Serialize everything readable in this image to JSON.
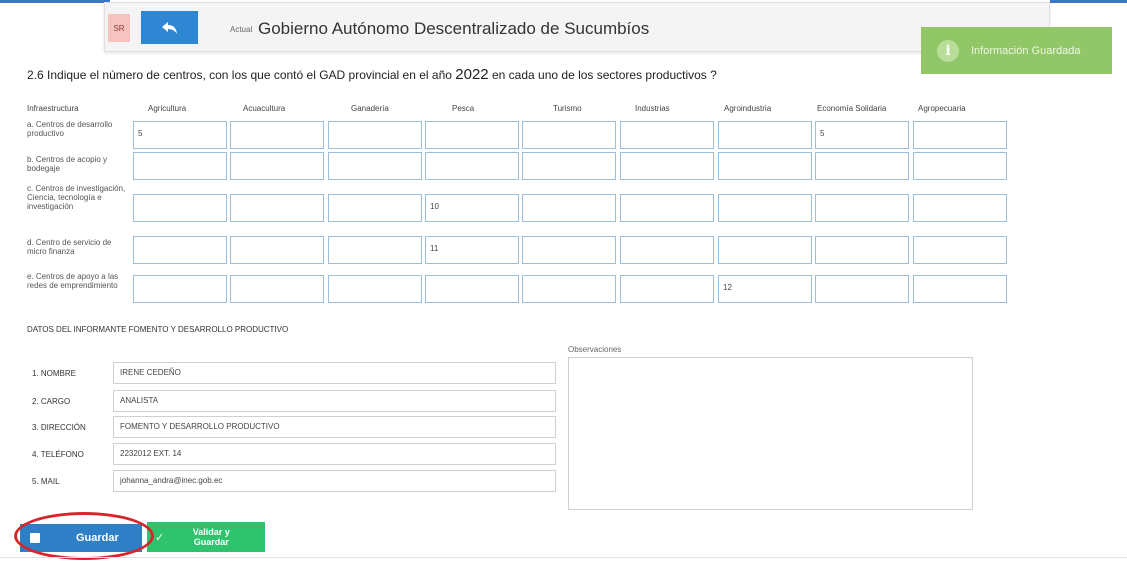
{
  "header": {
    "lang_label": "SR",
    "actual_label": "Actual",
    "entity_title": "Gobierno Autónomo Descentralizado de Sucumbíos"
  },
  "toast": {
    "icon": "info-icon",
    "text": "Información Guardada"
  },
  "question": {
    "prefix": "2.6 Indique el número de centros, con los que contó el GAD provincial en el año",
    "year": "2022",
    "suffix": "en cada uno de los sectores productivos ?"
  },
  "table": {
    "row_header": "Infraestructura",
    "columns": [
      "Agricultura",
      "Acuacultura",
      "Ganadería",
      "Pesca",
      "Turismo",
      "Industrias",
      "Agroindustria",
      "Economía Solidaria",
      "Agropecuaria"
    ],
    "rows": [
      {
        "label": "a. Centros de desarrollo productivo",
        "values": [
          "5",
          "",
          "",
          "",
          "",
          "",
          "",
          "5",
          ""
        ]
      },
      {
        "label": "b. Centros de acopio y bodegaje",
        "values": [
          "",
          "",
          "",
          "",
          "",
          "",
          "",
          "",
          ""
        ]
      },
      {
        "label": "c. Centros de investigación, Ciencia, tecnología e investigación",
        "values": [
          "",
          "",
          "",
          "10",
          "",
          "",
          "",
          "",
          ""
        ]
      },
      {
        "label": "d. Centro de servicio de micro finanza",
        "values": [
          "",
          "",
          "",
          "11",
          "",
          "",
          "",
          "",
          ""
        ]
      },
      {
        "label": "e. Centros de apoyo a las redes de emprendimiento",
        "values": [
          "",
          "",
          "",
          "",
          "",
          "",
          "12",
          "",
          ""
        ]
      }
    ]
  },
  "informante": {
    "title": "DATOS DEL INFORMANTE FOMENTO Y DESARROLLO PRODUCTIVO",
    "fields": [
      {
        "label": "1. NOMBRE",
        "value": "IRENE CEDEÑO"
      },
      {
        "label": "2. CARGO",
        "value": "ANALISTA"
      },
      {
        "label": "3. DIRECCIÓN",
        "value": "FOMENTO Y DESARROLLO PRODUCTIVO"
      },
      {
        "label": "4. TELÉFONO",
        "value": "2232012 EXT. 14"
      },
      {
        "label": "5. MAIL",
        "value": "johanna_andra@inec.gob.ec"
      }
    ],
    "observaciones_label": "Observaciones"
  },
  "buttons": {
    "guardar": "Guardar",
    "validar": "Validar y Guardar"
  },
  "colors": {
    "primary": "#2f7fc7",
    "success": "#2ec36c",
    "toast": "#8cc560",
    "highlight": "#d7262b"
  }
}
